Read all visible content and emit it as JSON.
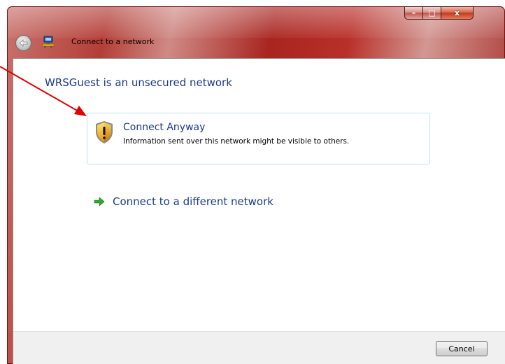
{
  "window": {
    "title": "Connect to a network",
    "minimize_glyph": "–",
    "maximize_glyph": "□",
    "close_glyph": "x",
    "frame_color": "#b43e37"
  },
  "icons": {
    "back": "back-arrow-icon",
    "network": "network-icon",
    "shield": "security-shield-warning-icon",
    "arrow": "green-arrow-icon"
  },
  "main": {
    "heading": "WRSGuest is an unsecured network",
    "options": [
      {
        "label": "Connect Anyway",
        "description": "Information sent over this network might be visible to others."
      },
      {
        "label": "Connect to a different network"
      }
    ]
  },
  "footer": {
    "cancel_label": "Cancel"
  },
  "colors": {
    "heading_text": "#1c3a8a",
    "option_border": "#bfe3f3",
    "annotation": "#e00000"
  }
}
